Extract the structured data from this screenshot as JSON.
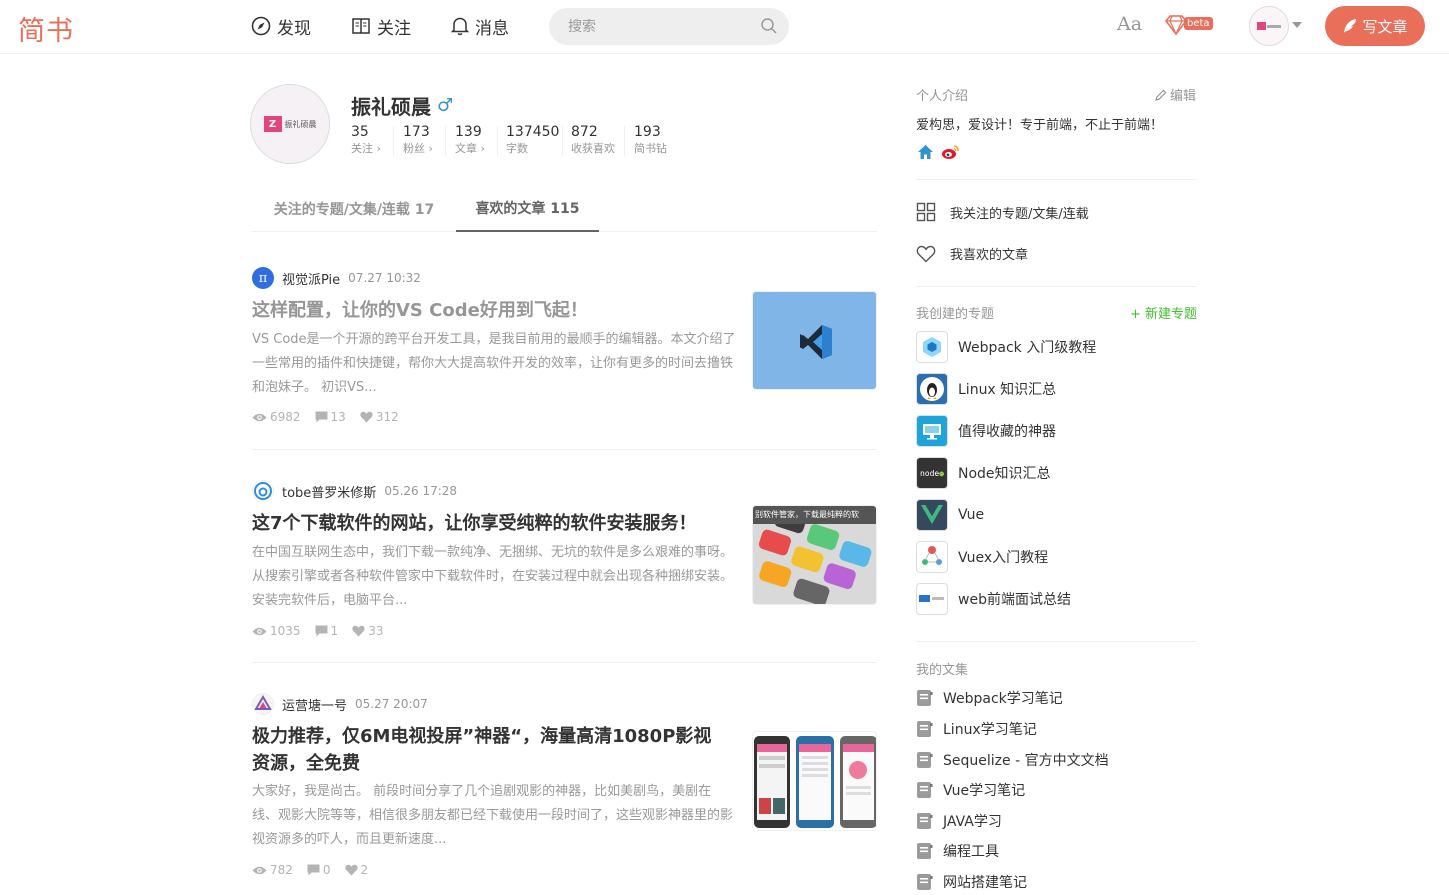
{
  "header": {
    "logo": "简书",
    "nav": [
      "发现",
      "关注",
      "消息"
    ],
    "search_placeholder": "搜索",
    "font_toggle": "Aa",
    "beta_label": "beta",
    "write_button": "写文章"
  },
  "profile": {
    "avatar_text_box": "Z",
    "avatar_text": "振礼硕晨",
    "name": "振礼硕晨",
    "gender_symbol": "♂",
    "stats": [
      {
        "num": "35",
        "label": "关注 ›"
      },
      {
        "num": "173",
        "label": "粉丝 ›"
      },
      {
        "num": "139",
        "label": "文章 ›"
      },
      {
        "num": "137450",
        "label": "字数"
      },
      {
        "num": "872",
        "label": "收获喜欢"
      },
      {
        "num": "193",
        "label": "简书钻"
      }
    ]
  },
  "tabs": [
    {
      "label": "关注的专题/文集/连载 17"
    },
    {
      "label": "喜欢的文章 115"
    }
  ],
  "articles": [
    {
      "author": "视觉派Pie",
      "time": "07.27 10:32",
      "title": "这样配置，让你的VS Code好用到飞起！",
      "abstract": "VS Code是一个开源的跨平台开发工具，是我目前用的最顺手的编辑器。本文介绍了一些常用的插件和快捷键，帮你大大提高软件开发的效率，让你有更多的时间去撸铁和泡妹子。 初识VS...",
      "views": "6982",
      "comments": "13",
      "likes": "312"
    },
    {
      "author": "tobe普罗米修斯",
      "time": "05.26 17:28",
      "title": "这7个下载软件的网站，让你享受纯粹的软件安装服务！",
      "abstract": "在中国互联网生态中，我们下载一款纯净、无捆绑、无坑的软件是多么艰难的事呀。从搜索引擎或者各种软件管家中下载软件时，在安装过程中就会出现各种捆绑安装。安装完软件后，电脑平台...",
      "views": "1035",
      "comments": "1",
      "likes": "33",
      "thumb_text": "别软件管家，下载最纯粹的软"
    },
    {
      "author": "运营塘一号",
      "time": "05.27 20:07",
      "title": "极力推荐，仅6M电视投屏”神器“，海量高清1080P影视资源，全免费",
      "abstract": "大家好，我是尚古。 前段时间分享了几个追剧观影的神器，比如美剧鸟，美剧在线、观影大院等等，相信很多朋友都已经下载使用一段时间了，这些观影神器里的影视资源多的吓人，而且更新速度...",
      "views": "782",
      "comments": "0",
      "likes": "2"
    }
  ],
  "sidebar": {
    "intro_title": "个人介绍",
    "edit_label": "编辑",
    "intro_text": "爱构思，爱设计！专于前端，不止于前端！",
    "links": [
      "我关注的专题/文集/连载",
      "我喜欢的文章"
    ],
    "topics_title": "我创建的专题",
    "new_topic": "+ 新建专题",
    "topics": [
      "Webpack 入门级教程",
      "Linux 知识汇总",
      "值得收藏的神器",
      "Node知识汇总",
      "Vue",
      "Vuex入门教程",
      "web前端面试总结"
    ],
    "notebooks_title": "我的文集",
    "notebooks": [
      "Webpack学习笔记",
      "Linux学习笔记",
      "Sequelize - 官方中文文档",
      "Vue学习笔记",
      "JAVA学习",
      "编程工具",
      "网站搭建笔记"
    ]
  }
}
